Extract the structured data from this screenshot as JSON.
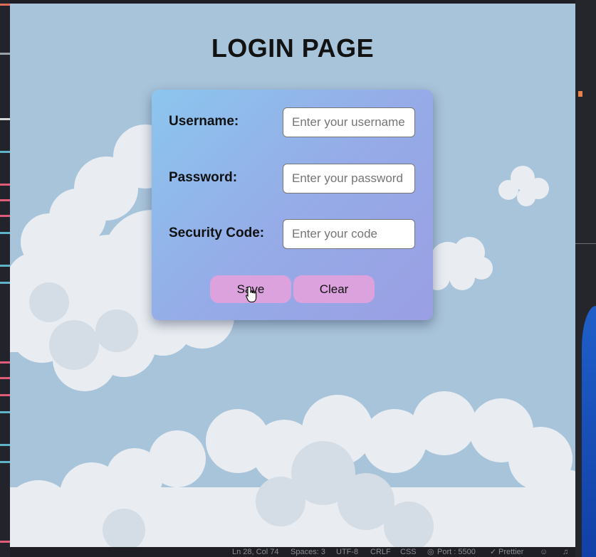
{
  "page": {
    "title": "LOGIN PAGE"
  },
  "form": {
    "fields": [
      {
        "label": "Username:",
        "placeholder": "Enter your username"
      },
      {
        "label": "Password:",
        "placeholder": "Enter your password"
      },
      {
        "label": "Security Code:",
        "placeholder": "Enter your code"
      }
    ],
    "buttons": {
      "save": "Save",
      "clear": "Clear"
    }
  },
  "status_bar": {
    "position": "Ln 28, Col 74",
    "spaces": "Spaces: 3",
    "encoding": "UTF-8",
    "eol": "CRLF",
    "language": "CSS",
    "port": "Port : 5500",
    "formatter": "Prettier"
  },
  "colors": {
    "sky_background": "#a8c4db",
    "card_gradient_start": "#8cc6ee",
    "card_gradient_end": "#9a9fe3",
    "button": "#dba2dd",
    "title": "#121212"
  },
  "icons": [
    "hand-pointer-icon",
    "broadcast-icon",
    "check-icon",
    "account-icon",
    "bell-icon"
  ]
}
